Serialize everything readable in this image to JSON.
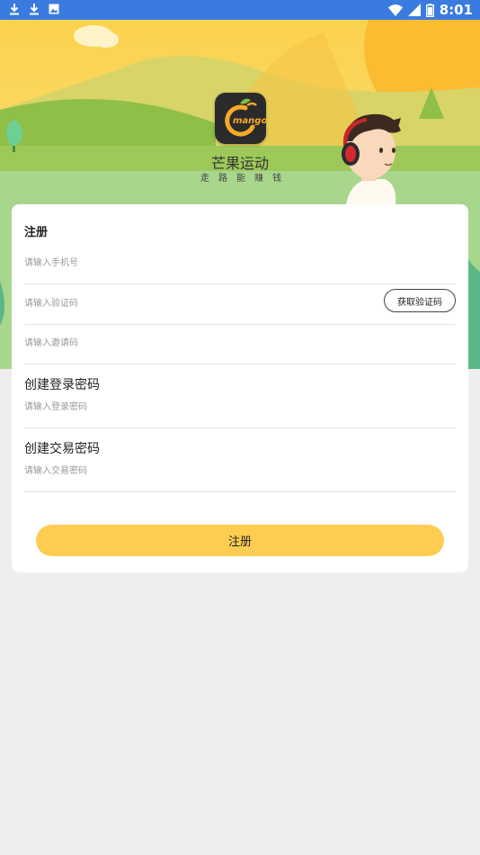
{
  "status_bar": {
    "time": "8:01",
    "left_icons": [
      "download-icon",
      "download-icon",
      "image-icon"
    ],
    "right_icons": [
      "wifi-icon",
      "signal-icon",
      "battery-icon"
    ]
  },
  "app": {
    "name": "芒果运动",
    "slogan": "走路能赚钱",
    "logo_text": "mango"
  },
  "form": {
    "title": "注册",
    "phone_placeholder": "请输入手机号",
    "code_placeholder": "请输入验证码",
    "get_code_label": "获取验证码",
    "invite_placeholder": "请输入邀请码",
    "login_pwd_title": "创建登录密码",
    "login_pwd_placeholder": "请输入登录密码",
    "trade_pwd_title": "创建交易密码",
    "trade_pwd_placeholder": "请输入交易密码",
    "submit_label": "注册"
  },
  "colors": {
    "status_bar": "#3a7be0",
    "accent": "#fdcd52",
    "background": "#efedef"
  }
}
